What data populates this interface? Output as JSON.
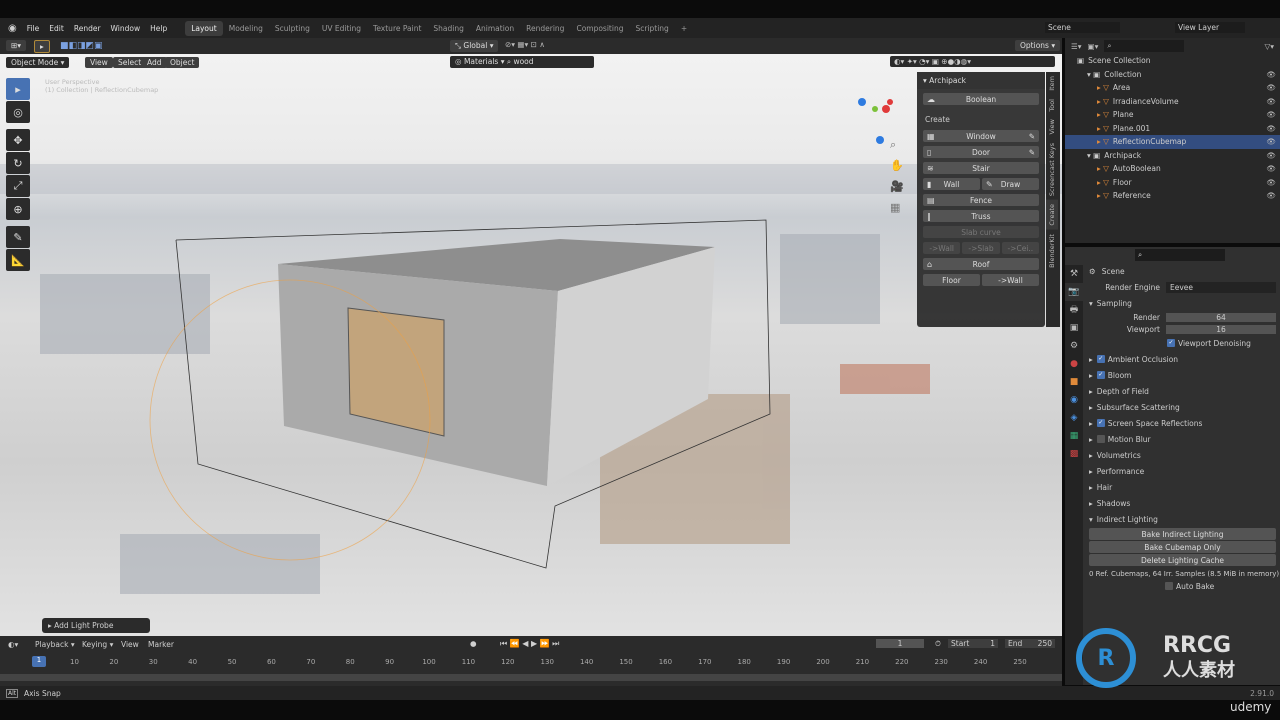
{
  "menu": [
    "File",
    "Edit",
    "Render",
    "Window",
    "Help"
  ],
  "workspaces": [
    "Layout",
    "Modeling",
    "Sculpting",
    "UV Editing",
    "Texture Paint",
    "Shading",
    "Animation",
    "Rendering",
    "Compositing",
    "Scripting"
  ],
  "scene": "Scene",
  "view_layer": "View Layer",
  "header": {
    "orientation": "Global",
    "options": "Options"
  },
  "viewport_header": {
    "mode": "Object Mode",
    "view": "View",
    "select": "Select",
    "add": "Add",
    "object": "Object",
    "materials": "Materials",
    "search_value": "wood"
  },
  "viewport_overlay": {
    "line1": "User Perspective",
    "line2": "(1) Collection | ReflectionCubemap"
  },
  "last_op": "Add Light Probe",
  "npanel": {
    "title": "Archipack",
    "boolean": "Boolean",
    "create": "Create",
    "window": "Window",
    "door": "Door",
    "stair": "Stair",
    "wall": "Wall",
    "draw": "Draw",
    "fence": "Fence",
    "truss": "Truss",
    "slab_curve": "Slab curve",
    "to_wall": "->Wall",
    "to_slab": "->Slab",
    "to_cei": "->Cei..",
    "roof": "Roof",
    "floor": "Floor",
    "floor_to_wall": "->Wall",
    "tabs": [
      "Item",
      "Tool",
      "View",
      "Screencast Keys",
      "Create",
      "BlenderKit"
    ]
  },
  "outliner": {
    "root": "Scene Collection",
    "items": [
      {
        "name": "Collection",
        "level": 1
      },
      {
        "name": "Area",
        "level": 2
      },
      {
        "name": "IrradianceVolume",
        "level": 2
      },
      {
        "name": "Plane",
        "level": 2
      },
      {
        "name": "Plane.001",
        "level": 2
      },
      {
        "name": "ReflectionCubemap",
        "level": 2,
        "selected": true
      },
      {
        "name": "Archipack",
        "level": 1
      },
      {
        "name": "AutoBoolean",
        "level": 2
      },
      {
        "name": "Floor",
        "level": 2
      },
      {
        "name": "Reference",
        "level": 2
      }
    ]
  },
  "properties": {
    "scene": "Scene",
    "render_engine_label": "Render Engine",
    "render_engine": "Eevee",
    "sampling": "Sampling",
    "render_label": "Render",
    "render": "64",
    "viewport_label": "Viewport",
    "viewport": "16",
    "denoise": "Viewport Denoising",
    "panels": [
      {
        "name": "Ambient Occlusion",
        "check": true
      },
      {
        "name": "Bloom",
        "check": true
      },
      {
        "name": "Depth of Field"
      },
      {
        "name": "Subsurface Scattering"
      },
      {
        "name": "Screen Space Reflections",
        "check": true
      },
      {
        "name": "Motion Blur",
        "check": false
      },
      {
        "name": "Volumetrics"
      },
      {
        "name": "Performance"
      },
      {
        "name": "Hair"
      },
      {
        "name": "Shadows"
      },
      {
        "name": "Indirect Lighting"
      }
    ],
    "bake_indirect": "Bake Indirect Lighting",
    "bake_cubemap": "Bake Cubemap Only",
    "delete_cache": "Delete Lighting Cache",
    "info": "0 Ref. Cubemaps, 64 Irr. Samples (8.5 MiB in memory)",
    "auto_bake": "Auto Bake"
  },
  "timeline": {
    "playback": "Playback",
    "keying": "Keying",
    "view": "View",
    "marker": "Marker",
    "current": "1",
    "start_label": "Start",
    "start": "1",
    "end_label": "End",
    "end": "250",
    "ticks": [
      "10",
      "20",
      "30",
      "40",
      "50",
      "60",
      "70",
      "80",
      "90",
      "100",
      "110",
      "120",
      "130",
      "140",
      "150",
      "160",
      "170",
      "180",
      "190",
      "200",
      "210",
      "220",
      "230",
      "240",
      "250"
    ]
  },
  "status": {
    "key": "Alt",
    "hint": "Axis Snap",
    "version": "2.91.0"
  },
  "watermark": "RRCG 人人素材",
  "brand": "udemy",
  "colors": {
    "accent": "#4772b3",
    "selection": "#334d80"
  }
}
